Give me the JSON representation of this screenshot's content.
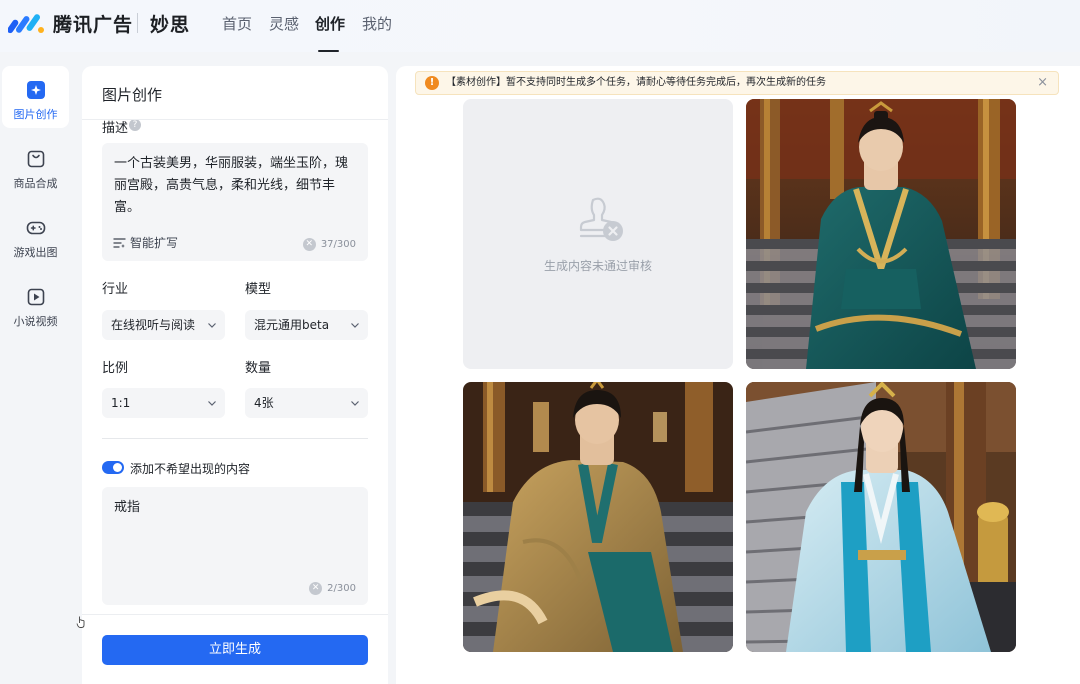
{
  "header": {
    "brand": "腾讯广告",
    "product": "妙思",
    "nav": [
      {
        "label": "首页",
        "active": false
      },
      {
        "label": "灵感",
        "active": false
      },
      {
        "label": "创作",
        "active": true
      },
      {
        "label": "我的",
        "active": false
      }
    ]
  },
  "sidebar": {
    "items": [
      {
        "label": "图片创作",
        "icon": "image-sparkle-icon",
        "active": true
      },
      {
        "label": "商品合成",
        "icon": "shopping-bag-icon",
        "active": false
      },
      {
        "label": "游戏出图",
        "icon": "gamepad-icon",
        "active": false
      },
      {
        "label": "小说视频",
        "icon": "video-play-icon",
        "active": false
      }
    ]
  },
  "form": {
    "title": "图片创作",
    "description": {
      "label": "描述",
      "value": "一个古装美男，华丽服装，端坐玉阶，瑰丽宫殿，高贵气息，柔和光线，细节丰富。",
      "expand_label": "智能扩写",
      "counter": "37/300"
    },
    "industry": {
      "label": "行业",
      "value": "在线视听与阅读"
    },
    "model": {
      "label": "模型",
      "value": "混元通用beta"
    },
    "ratio": {
      "label": "比例",
      "value": "1:1"
    },
    "quantity": {
      "label": "数量",
      "value": "4张"
    },
    "negative": {
      "toggle_label": "添加不希望出现的内容",
      "enabled": true,
      "value": "戒指",
      "counter": "2/300"
    },
    "submit_label": "立即生成"
  },
  "results": {
    "notice": "【素材创作】暂不支持同时生成多个任务，请耐心等待任务完成后，再次生成新的任务",
    "blocked_text": "生成内容未通过审核",
    "images": [
      {
        "status": "blocked"
      },
      {
        "status": "ok",
        "subject": "teal-robe-man-on-steps"
      },
      {
        "status": "ok",
        "subject": "gold-robe-man-seated"
      },
      {
        "status": "ok",
        "subject": "light-blue-robe-man-seated"
      }
    ]
  },
  "colors": {
    "accent": "#2469f2",
    "warning": "#f08a1f",
    "notice_bg": "#fdf6e8"
  }
}
